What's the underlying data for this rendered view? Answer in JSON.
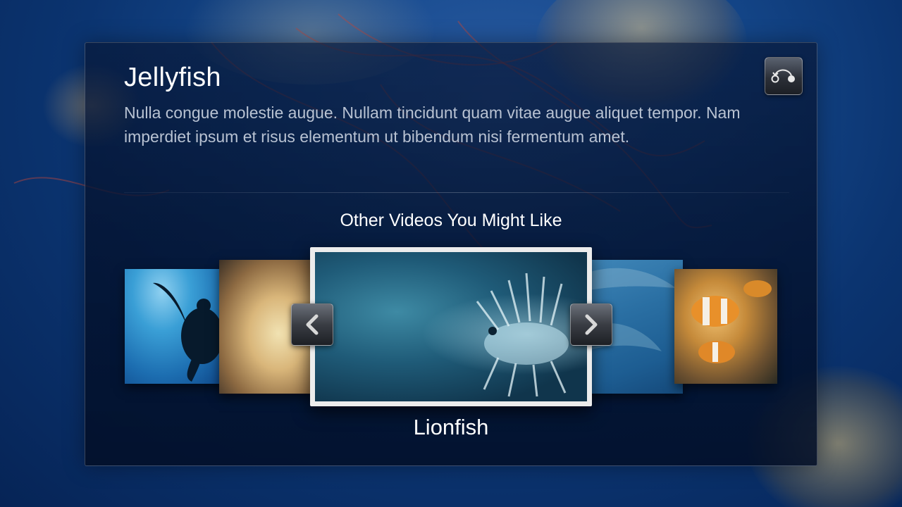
{
  "video": {
    "title": "Jellyfish",
    "description": "Nulla congue molestie augue. Nullam tincidunt quam vitae augue aliquet tempor. Nam imperdiet ipsum et risus elementum ut bibendum nisi fermentum amet."
  },
  "header": {
    "back_icon": "back-arrow-icon"
  },
  "recommendations": {
    "heading": "Other Videos You Might Like",
    "selected_title": "Lionfish",
    "prev_icon": "chevron-left-icon",
    "next_icon": "chevron-right-icon"
  },
  "colors": {
    "panel_background": "#04122e",
    "accent_text": "#ffffff",
    "secondary_text": "#b8c2d2",
    "selection_border": "#ececec"
  }
}
